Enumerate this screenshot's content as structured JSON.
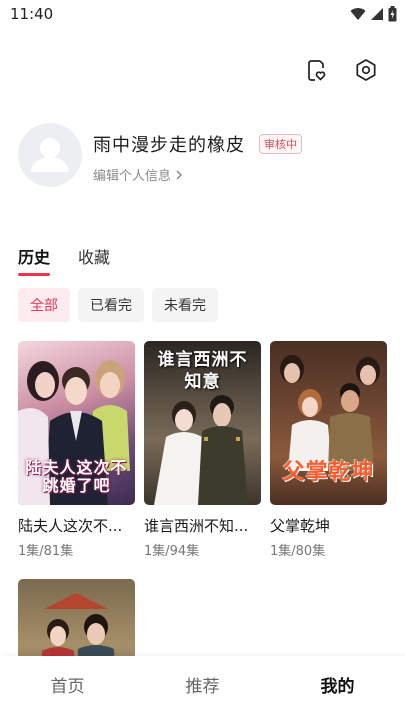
{
  "status_bar": {
    "time": "11:40"
  },
  "profile": {
    "username": "雨中漫步走的橡皮",
    "badge": "审核中",
    "edit_link": "编辑个人信息"
  },
  "tabs": [
    {
      "label": "历史",
      "active": true
    },
    {
      "label": "收藏",
      "active": false
    }
  ],
  "filters": [
    {
      "label": "全部",
      "active": true
    },
    {
      "label": "已看完",
      "active": false
    },
    {
      "label": "未看完",
      "active": false
    }
  ],
  "dramas": [
    {
      "title": "陆夫人这次不...",
      "progress": "1集/81集",
      "poster_text": "陆夫人这次不跳婚了吧"
    },
    {
      "title": "谁言西洲不知...",
      "progress": "1集/94集",
      "poster_text": "谁言西洲不知意"
    },
    {
      "title": "父掌乾坤",
      "progress": "1集/80集",
      "poster_text": "父掌乾坤"
    },
    {
      "title": "",
      "progress": "",
      "poster_text": ""
    }
  ],
  "bottom_nav": [
    {
      "label": "首页",
      "active": false
    },
    {
      "label": "推荐",
      "active": false
    },
    {
      "label": "我的",
      "active": true
    }
  ],
  "colors": {
    "accent": "#f0314c",
    "chip_active_bg": "#fdecef",
    "chip_bg": "#f4f4f4"
  }
}
